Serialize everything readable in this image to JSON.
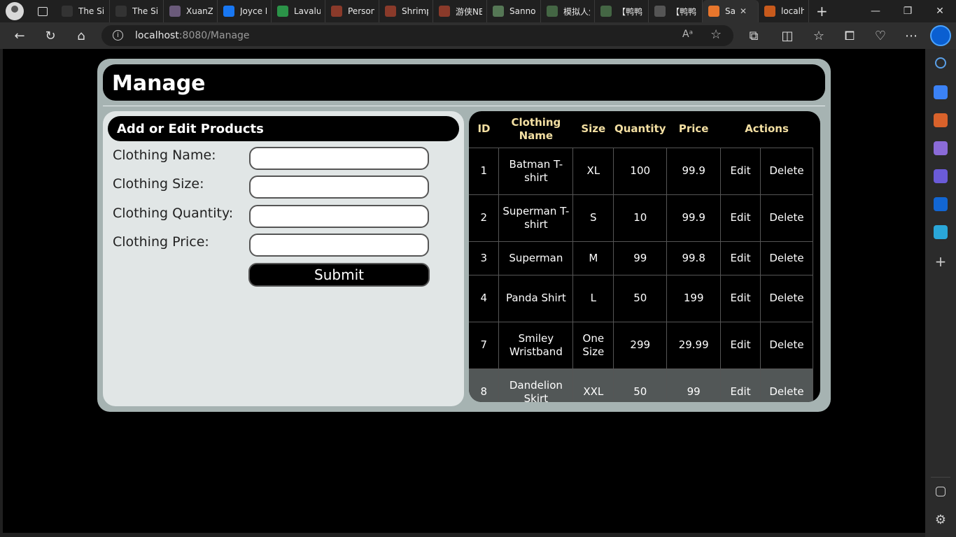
{
  "browser": {
    "tabs": [
      {
        "title": "The Sim",
        "favicon": "tsr",
        "color": "#333333"
      },
      {
        "title": "The Sim",
        "favicon": "tsr",
        "color": "#333333"
      },
      {
        "title": "XuanZi",
        "favicon": "pixel",
        "color": "#6a5a7a"
      },
      {
        "title": "Joyce E",
        "favicon": "facebook",
        "color": "#1877f2"
      },
      {
        "title": "Lavalus",
        "favicon": "drive",
        "color": "#2b9348"
      },
      {
        "title": "Persona",
        "favicon": "game",
        "color": "#8a3a2a"
      },
      {
        "title": "Shrimp",
        "favicon": "game",
        "color": "#8a3a2a"
      },
      {
        "title": "游侠NE",
        "favicon": "game",
        "color": "#8a3a2a"
      },
      {
        "title": "Sannon",
        "favicon": "leaf",
        "color": "#557755"
      },
      {
        "title": "模拟人生",
        "favicon": "leaf",
        "color": "#446644"
      },
      {
        "title": "【鸭鸭",
        "favicon": "leaf",
        "color": "#446644"
      },
      {
        "title": "【鸭鸭",
        "favicon": "controller",
        "color": "#555555"
      },
      {
        "title": "Sa",
        "favicon": "flame",
        "color": "#e8762c",
        "active": true
      },
      {
        "title": "localho",
        "favicon": "flame",
        "color": "#c85a1c"
      }
    ],
    "address": {
      "host": "localhost",
      "rest": ":8080/Manage"
    }
  },
  "page": {
    "title": "Manage",
    "form": {
      "heading": "Add or Edit Products",
      "fields": [
        {
          "label": "Clothing Name:",
          "value": ""
        },
        {
          "label": "Clothing Size:",
          "value": ""
        },
        {
          "label": "Clothing Quantity:",
          "value": ""
        },
        {
          "label": "Clothing Price:",
          "value": ""
        }
      ],
      "submit_label": "Submit"
    },
    "table": {
      "headers": [
        "ID",
        "Clothing Name",
        "Size",
        "Quantity",
        "Price",
        "Actions"
      ],
      "edit_label": "Edit",
      "delete_label": "Delete",
      "rows": [
        {
          "id": "1",
          "name": "Batman T-shirt",
          "size": "XL",
          "quantity": "100",
          "price": "99.9"
        },
        {
          "id": "2",
          "name": "Superman T-shirt",
          "size": "S",
          "quantity": "10",
          "price": "99.9"
        },
        {
          "id": "3",
          "name": "Superman",
          "size": "M",
          "quantity": "99",
          "price": "99.8"
        },
        {
          "id": "4",
          "name": "Panda Shirt",
          "size": "L",
          "quantity": "50",
          "price": "199"
        },
        {
          "id": "7",
          "name": "Smiley Wristband",
          "size": "One Size",
          "quantity": "299",
          "price": "29.99"
        },
        {
          "id": "8",
          "name": "Dandelion Skirt",
          "size": "XXL",
          "quantity": "50",
          "price": "99"
        }
      ]
    }
  }
}
